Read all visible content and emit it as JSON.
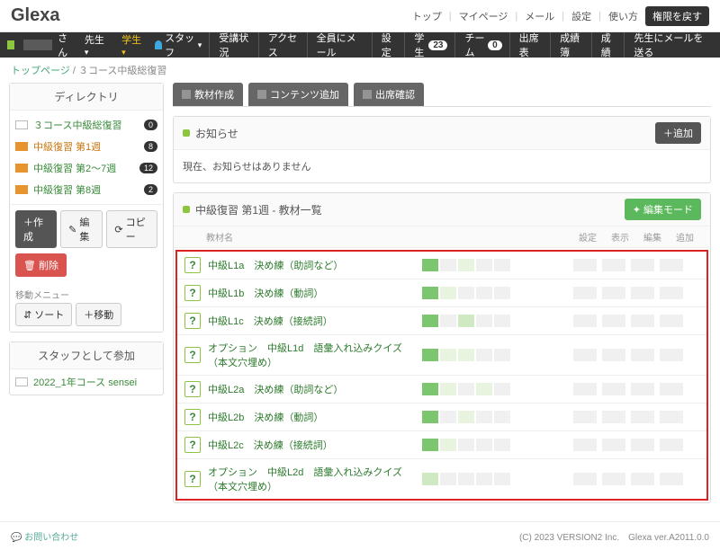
{
  "logo": "Glexa",
  "top_links": [
    "トップ",
    "マイページ",
    "メール",
    "設定",
    "使い方"
  ],
  "btn_perm": "権限を戻す",
  "user_suffix": "さん",
  "role1": "先生",
  "role2": "学生",
  "nav": {
    "staff": "スタッフ",
    "items": [
      "受講状況",
      "アクセス",
      "全員にメール",
      "設定"
    ],
    "gakusei": "学生",
    "gakusei_count": "23",
    "team": "チーム",
    "team_count": "0",
    "more": [
      "出席表",
      "成績簿",
      "成績",
      "先生にメールを送る"
    ]
  },
  "breadcrumb": {
    "top": "トップページ",
    "sep": "/",
    "current": "３コース中級総復習"
  },
  "sidebar": {
    "dir_title": "ディレクトリ",
    "items": [
      {
        "label": "３コース中級総復習",
        "count": "0",
        "type": "m",
        "cls": ""
      },
      {
        "label": "中級復習 第1週",
        "count": "8",
        "type": "f",
        "cls": "orange"
      },
      {
        "label": "中級復習 第2〜7週",
        "count": "12",
        "type": "f",
        "cls": ""
      },
      {
        "label": "中級復習 第8週",
        "count": "2",
        "type": "f",
        "cls": ""
      }
    ],
    "btn_create": "＋作成",
    "btn_edit": "編集",
    "btn_copy": "コピー",
    "btn_delete": "削除",
    "move_title": "移動メニュー",
    "btn_sort": "ソート",
    "btn_move": "＋移動",
    "staff_title": "スタッフとして参加",
    "staff_item": "2022_1年コース sensei"
  },
  "tabs": [
    "教材作成",
    "コンテンツ追加",
    "出席確認"
  ],
  "notice": {
    "title": "お知らせ",
    "btn": "＋追加",
    "body": "現在、お知らせはありません"
  },
  "materials": {
    "title": "中級復習 第1週 - 教材一覧",
    "btn": "編集モード",
    "col_name": "教材名",
    "cols": [
      "設定",
      "表示",
      "編集",
      "追加"
    ],
    "rows": [
      "中級L1a　決め練（助詞など）",
      "中級L1b　決め練（動詞）",
      "中級L1c　決め練（接続詞）",
      "オプション　中級L1d　語彙入れ込みクイズ（本文穴埋め）",
      "中級L2a　決め練（助詞など）",
      "中級L2b　決め練（動詞）",
      "中級L2c　決め練（接続詞）",
      "オプション　中級L2d　語彙入れ込みクイズ（本文穴埋め）"
    ]
  },
  "footer": {
    "contact": "お問い合わせ",
    "copy": "(C) 2023 VERSION2 Inc.　Glexa ver.A2011.0.0"
  }
}
